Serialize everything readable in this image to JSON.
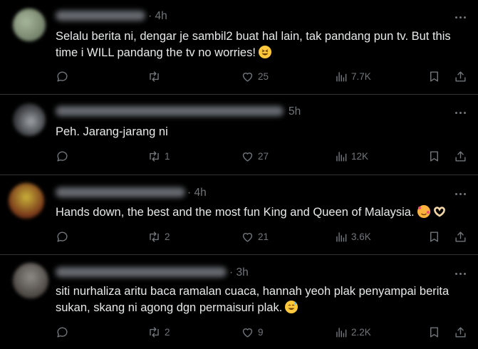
{
  "posts": [
    {
      "time": "4h",
      "text": "Selalu berita ni, dengar je sambil2 buat hal lain, tak pandang pun tv. But this time i WILL pandang the tv no worries!",
      "emoji": "grinning-squinting-face",
      "reposts": "",
      "likes": "25",
      "views": "7.7K"
    },
    {
      "time": "5h",
      "text": "Peh. Jarang-jarang ni",
      "reposts": "1",
      "likes": "27",
      "views": "12K"
    },
    {
      "time": "4h",
      "text": "Hands down, the best and the most fun King and Queen of Malaysia.",
      "emoji": "smiling-face-with-hearts and heart-hands",
      "reposts": "2",
      "likes": "21",
      "views": "3.6K"
    },
    {
      "time": "3h",
      "text": "siti nurhaliza aritu baca ramalan cuaca, hannah yeoh plak penyampai berita sukan, skang ni agong dgn permaisuri plak.",
      "emoji": "grinning-face-with-sweat",
      "reposts": "2",
      "likes": "9",
      "views": "2.2K"
    }
  ]
}
